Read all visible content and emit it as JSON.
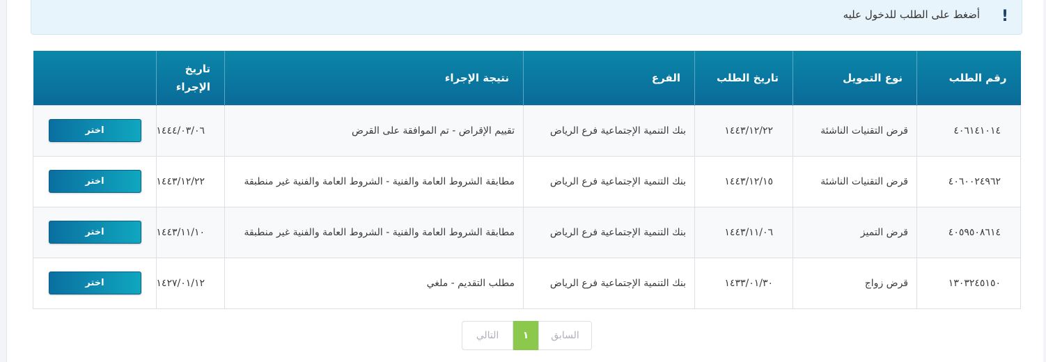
{
  "alert": {
    "icon": "exclamation-icon",
    "text": "أضغط على الطلب للدخول عليه"
  },
  "table": {
    "headers": {
      "request_number": "رقم الطلب",
      "finance_type": "نوع التمويل",
      "request_date": "تاريخ الطلب",
      "branch": "الفرع",
      "procedure_result": "نتيجة الإجراء",
      "procedure_date": "تاريخ الإجراء",
      "action": ""
    },
    "rows": [
      {
        "request_number": "٤٠٦١٤١٠١٤",
        "finance_type": "قرض التقنيات الناشئة",
        "request_date": "١٤٤٣/١٢/٢٢",
        "branch": "بنك التنمية الإجتماعية فرع الرياض",
        "procedure_result": "تقييم الإقراض - تم الموافقة على القرض",
        "procedure_date": "١٤٤٤/٠٣/٠٦",
        "action": "اختر"
      },
      {
        "request_number": "٤٠٦٠٠٢٤٩٦٢",
        "finance_type": "قرض التقنيات الناشئة",
        "request_date": "١٤٤٣/١٢/١٥",
        "branch": "بنك التنمية الإجتماعية فرع الرياض",
        "procedure_result": "مطابقة الشروط العامة والفنية - الشروط العامة والفنية غير منطبقة",
        "procedure_date": "١٤٤٣/١٢/٢٢",
        "action": "اختر"
      },
      {
        "request_number": "٤٠٥٩٥٠٨٦١٤",
        "finance_type": "قرض التميز",
        "request_date": "١٤٤٣/١١/٠٦",
        "branch": "بنك التنمية الإجتماعية فرع الرياض",
        "procedure_result": "مطابقة الشروط العامة والفنية - الشروط العامة والفنية غير منطبقة",
        "procedure_date": "١٤٤٣/١١/١٠",
        "action": "اختر"
      },
      {
        "request_number": "١٣٠٣٢٤٥١٥٠",
        "finance_type": "قرض زواج",
        "request_date": "١٤٣٣/٠١/٣٠",
        "branch": "بنك التنمية الإجتماعية فرع الرياض",
        "procedure_result": "مطلب التقديم - ملغي",
        "procedure_date": "١٤٢٧/٠١/١٢",
        "action": "اختر"
      }
    ]
  },
  "pagination": {
    "previous": "السابق",
    "current": "١",
    "next": "التالي"
  }
}
